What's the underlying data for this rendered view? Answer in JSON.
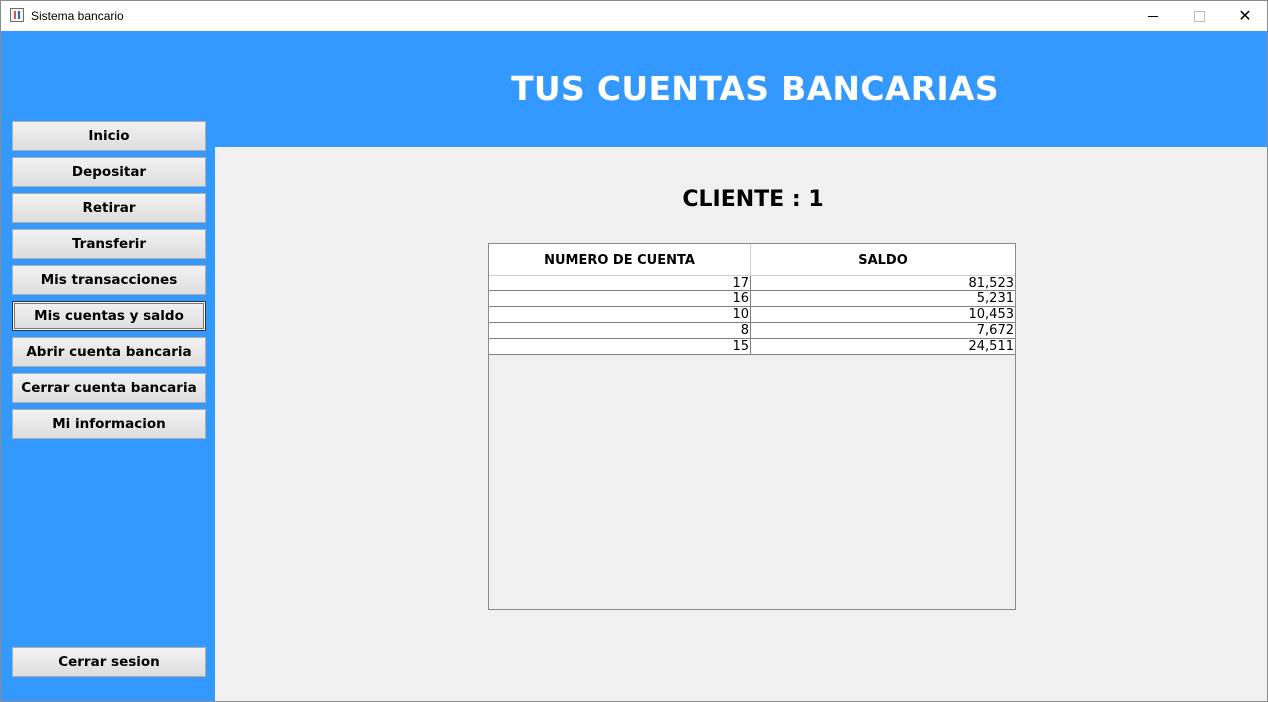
{
  "window": {
    "title": "Sistema bancario"
  },
  "header": {
    "title": "TUS CUENTAS BANCARIAS"
  },
  "sidebar": {
    "items": [
      {
        "label": "Inicio"
      },
      {
        "label": "Depositar"
      },
      {
        "label": "Retirar"
      },
      {
        "label": "Transferir"
      },
      {
        "label": "Mis transacciones"
      },
      {
        "label": "Mis cuentas y saldo"
      },
      {
        "label": "Abrir cuenta bancaria"
      },
      {
        "label": "Cerrar cuenta bancaria"
      },
      {
        "label": "Mi informacion"
      }
    ],
    "logout_label": "Cerrar sesion"
  },
  "main": {
    "client_label": "CLIENTE : 1",
    "table": {
      "columns": [
        "NUMERO DE CUENTA",
        "SALDO"
      ],
      "rows": [
        [
          "17",
          "81,523"
        ],
        [
          "16",
          "5,231"
        ],
        [
          "10",
          "10,453"
        ],
        [
          "8",
          "7,672"
        ],
        [
          "15",
          "24,511"
        ]
      ]
    }
  },
  "colors": {
    "accent": "#3399ff",
    "content_background": "#f0f0f0"
  },
  "icons": {
    "app": "java-app-icon",
    "minimize": "minimize-icon",
    "maximize": "maximize-icon",
    "close": "close-icon"
  }
}
